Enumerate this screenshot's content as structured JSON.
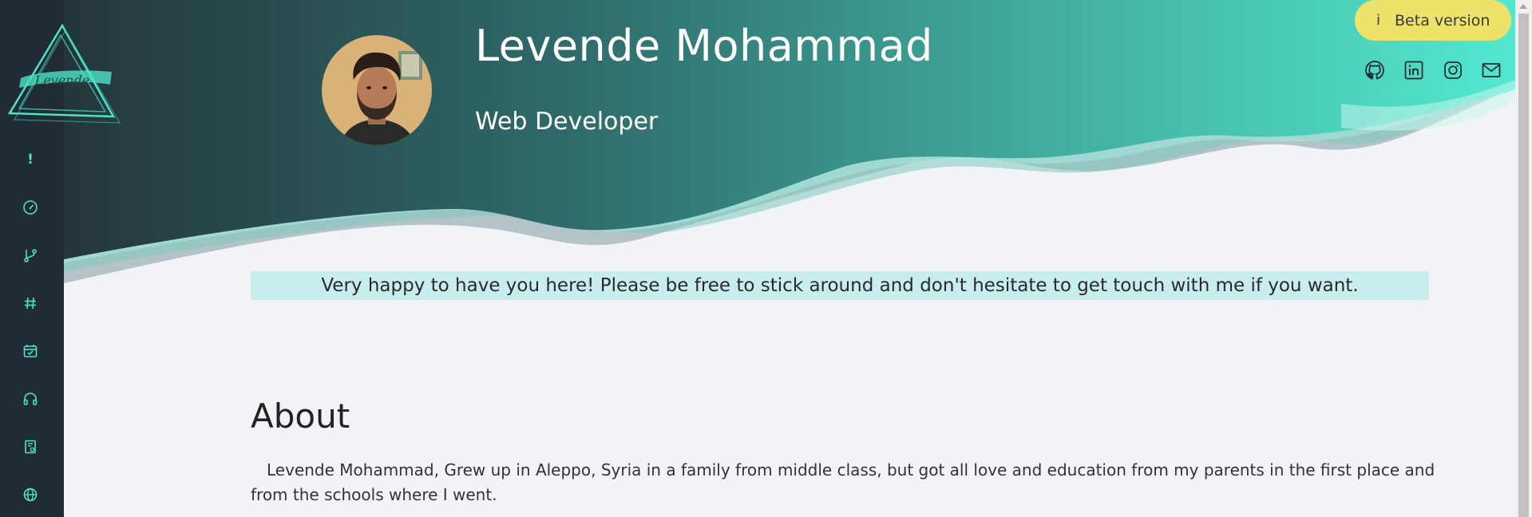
{
  "profile": {
    "name": "Levende Mohammad",
    "role": "Web Developer"
  },
  "logo": {
    "text": "Levende"
  },
  "beta": {
    "icon": "i",
    "label": "Beta version"
  },
  "sidebar": {
    "items": [
      {
        "icon": "exclamation-icon",
        "glyph": "!"
      },
      {
        "icon": "gauge-icon"
      },
      {
        "icon": "git-branch-icon"
      },
      {
        "icon": "hash-icon"
      },
      {
        "icon": "calendar-check-icon"
      },
      {
        "icon": "headphones-icon"
      },
      {
        "icon": "document-icon"
      },
      {
        "icon": "globe-icon"
      }
    ]
  },
  "social": [
    {
      "icon": "github-icon"
    },
    {
      "icon": "linkedin-icon"
    },
    {
      "icon": "instagram-icon"
    },
    {
      "icon": "mail-icon"
    }
  ],
  "welcome": {
    "text": "Very happy to have you here! Please be free to stick around and don't hesitate to get touch with me if you want."
  },
  "about": {
    "title": "About",
    "text": "Levende Mohammad, Grew up in Aleppo, Syria in a family from middle class, but got all love and education from my parents in the first place and from the schools where I went."
  },
  "colors": {
    "sidebar": "#212b33",
    "accent": "#4de2c8",
    "beta": "#ede26a",
    "welcome_bg": "#c8edee",
    "page_bg": "#f2f3f6"
  }
}
